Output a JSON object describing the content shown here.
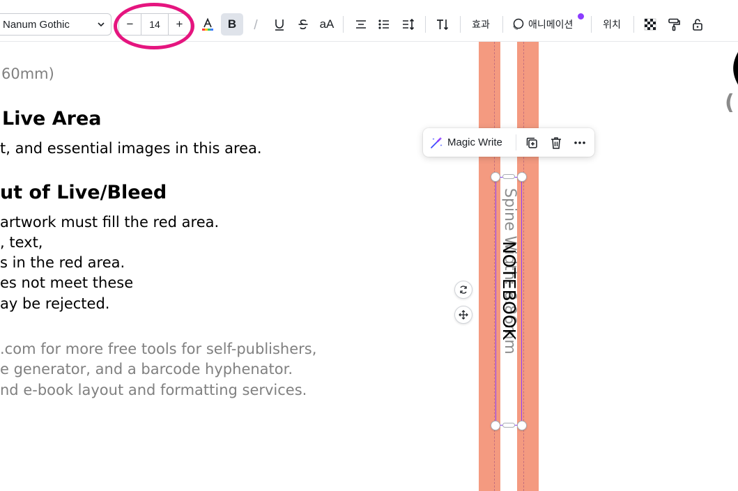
{
  "toolbar": {
    "font_family": "Nanum Gothic",
    "font_size": "14",
    "decrease_label": "−",
    "increase_label": "+",
    "bold_label": "B",
    "case_label": "aA",
    "effects_label": "효과",
    "animate_label": "애니메이션",
    "position_label": "위치"
  },
  "document": {
    "lines": [
      "60mm)",
      "Live Area",
      "t, and essential images in this area.",
      "ut of Live/Bleed",
      "artwork must fill the red area.",
      ", text,",
      "s in the red area.",
      "es not meet these",
      "ay be rejected.",
      ".com for more free tools for self-publishers,",
      "e generator, and a barcode hyphenator.",
      "nd e-book layout and formatting services."
    ]
  },
  "spine": {
    "placeholder_text": "Spine Width: 6.86mm",
    "title_text": "NOTEBOOK"
  },
  "popup": {
    "magic_write_label": "Magic Write"
  },
  "right_edge": {
    "big_char": "(",
    "small_char": "("
  },
  "colors": {
    "accent": "#8b3dff",
    "bleed_red": "#f49a80",
    "highlight_pink": "#e5157f"
  }
}
